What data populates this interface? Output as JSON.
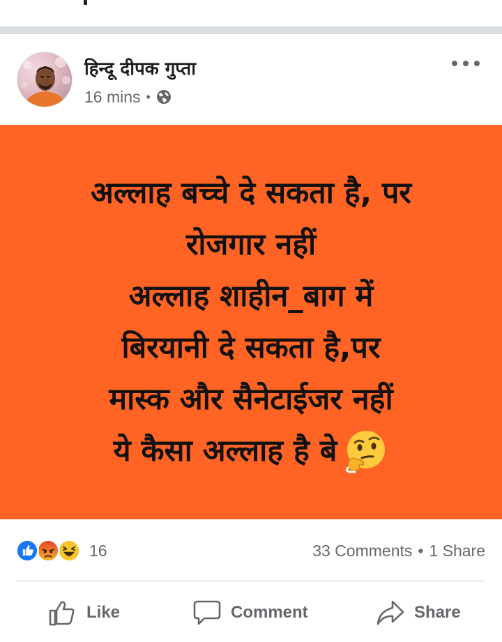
{
  "post": {
    "author": "हिन्दू दीपक गुप्ता",
    "time": "16 mins",
    "separator": "•",
    "privacy_icon": "globe-icon",
    "more_icon": "more-options-icon"
  },
  "image_card": {
    "background_color": "#ff6424",
    "lines": [
      "अल्लाह बच्चे दे सकता है, पर",
      "रोजगार नहीं",
      "अल्लाह शाहीन_बाग में",
      "बिरयानी दे सकता है,पर",
      "मास्क और सैनेटाईजर नहीं",
      "ये कैसा अल्लाह है बे"
    ],
    "emoji": "thinking-face-icon"
  },
  "reactions": {
    "icons": [
      "like-reaction-icon",
      "angry-reaction-icon",
      "haha-reaction-icon"
    ],
    "count": "16",
    "comments": "33 Comments",
    "dot": "•",
    "shares": "1 Share"
  },
  "actions": {
    "like": "Like",
    "comment": "Comment",
    "share": "Share"
  },
  "colors": {
    "facebook_blue": "#1877f2",
    "text_secondary": "#65676b",
    "text_primary": "#1c1e21"
  }
}
